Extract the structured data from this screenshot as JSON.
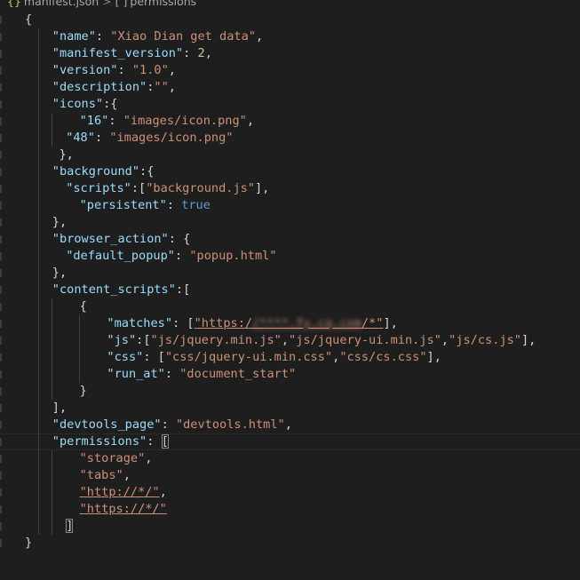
{
  "breadcrumb": {
    "icon": "json-braces-icon",
    "file": "manifest.json",
    "separator": ">",
    "symbol_icon": "[ ]",
    "symbol": "permissions"
  },
  "colors": {
    "background": "#1e1e1e",
    "key": "#9cdcfe",
    "string": "#ce9178",
    "number": "#b5cea8",
    "boolean": "#569cd6",
    "punctuation": "#d4d4d4"
  },
  "lines": [
    {
      "indent": 0,
      "guides": 0,
      "tokens": [
        {
          "t": "p",
          "v": "{"
        }
      ]
    },
    {
      "indent": 2,
      "guides": 1,
      "tokens": [
        {
          "t": "k",
          "v": "\"name\""
        },
        {
          "t": "p",
          "v": ": "
        },
        {
          "t": "s",
          "v": "\"Xiao Dian get data\""
        },
        {
          "t": "p",
          "v": ","
        }
      ]
    },
    {
      "indent": 2,
      "guides": 1,
      "tokens": [
        {
          "t": "k",
          "v": "\"manifest_version\""
        },
        {
          "t": "p",
          "v": ": "
        },
        {
          "t": "n",
          "v": "2"
        },
        {
          "t": "p",
          "v": ","
        }
      ]
    },
    {
      "indent": 2,
      "guides": 1,
      "tokens": [
        {
          "t": "k",
          "v": "\"version\""
        },
        {
          "t": "p",
          "v": ": "
        },
        {
          "t": "s",
          "v": "\"1.0\""
        },
        {
          "t": "p",
          "v": ","
        }
      ]
    },
    {
      "indent": 2,
      "guides": 1,
      "tokens": [
        {
          "t": "k",
          "v": "\"description\""
        },
        {
          "t": "p",
          "v": ":"
        },
        {
          "t": "s",
          "v": "\"\""
        },
        {
          "t": "p",
          "v": ","
        }
      ]
    },
    {
      "indent": 2,
      "guides": 1,
      "tokens": [
        {
          "t": "k",
          "v": "\"icons\""
        },
        {
          "t": "p",
          "v": ":{"
        }
      ]
    },
    {
      "indent": 4,
      "guides": 2,
      "tokens": [
        {
          "t": "k",
          "v": "\"16\""
        },
        {
          "t": "p",
          "v": ": "
        },
        {
          "t": "s",
          "v": "\"images/icon.png\""
        },
        {
          "t": "p",
          "v": ","
        }
      ]
    },
    {
      "indent": 3,
      "guides": 2,
      "tokens": [
        {
          "t": "k",
          "v": "\"48\""
        },
        {
          "t": "p",
          "v": ": "
        },
        {
          "t": "s",
          "v": "\"images/icon.png\""
        }
      ]
    },
    {
      "indent": 2.5,
      "guides": 1,
      "tokens": [
        {
          "t": "p",
          "v": "},"
        }
      ]
    },
    {
      "indent": 2,
      "guides": 1,
      "tokens": [
        {
          "t": "k",
          "v": "\"background\""
        },
        {
          "t": "p",
          "v": ":{"
        }
      ]
    },
    {
      "indent": 3,
      "guides": 1,
      "tokens": [
        {
          "t": "k",
          "v": "\"scripts\""
        },
        {
          "t": "p",
          "v": ":["
        },
        {
          "t": "s",
          "v": "\"background.js\""
        },
        {
          "t": "p",
          "v": "],"
        }
      ]
    },
    {
      "indent": 4,
      "guides": 1,
      "tokens": [
        {
          "t": "k",
          "v": "\"persistent\""
        },
        {
          "t": "p",
          "v": ": "
        },
        {
          "t": "b",
          "v": "true"
        }
      ]
    },
    {
      "indent": 2,
      "guides": 1,
      "tokens": [
        {
          "t": "p",
          "v": "},"
        }
      ]
    },
    {
      "indent": 2,
      "guides": 1,
      "tokens": [
        {
          "t": "k",
          "v": "\"browser_action\""
        },
        {
          "t": "p",
          "v": ": {"
        }
      ]
    },
    {
      "indent": 3,
      "guides": 1,
      "tokens": [
        {
          "t": "k",
          "v": "\"default_popup\""
        },
        {
          "t": "p",
          "v": ": "
        },
        {
          "t": "s",
          "v": "\"popup.html\""
        }
      ]
    },
    {
      "indent": 2,
      "guides": 1,
      "tokens": [
        {
          "t": "p",
          "v": "},"
        }
      ]
    },
    {
      "indent": 2,
      "guides": 1,
      "tokens": [
        {
          "t": "k",
          "v": "\"content_scripts\""
        },
        {
          "t": "p",
          "v": ":["
        }
      ]
    },
    {
      "indent": 4,
      "guides": 2,
      "tokens": [
        {
          "t": "p",
          "v": "{"
        }
      ]
    },
    {
      "indent": 6,
      "guides": 3,
      "tokens": [
        {
          "t": "k",
          "v": "\"matches\""
        },
        {
          "t": "p",
          "v": ": ["
        },
        {
          "t": "su",
          "v": "\"https:/"
        },
        {
          "t": "blur",
          "v": "/****.fy.cq.com"
        },
        {
          "t": "su",
          "v": "/*\""
        },
        {
          "t": "p",
          "v": "],"
        }
      ]
    },
    {
      "indent": 6,
      "guides": 3,
      "tokens": [
        {
          "t": "k",
          "v": "\"js\""
        },
        {
          "t": "p",
          "v": ":["
        },
        {
          "t": "s",
          "v": "\"js/jquery.min.js\""
        },
        {
          "t": "p",
          "v": ","
        },
        {
          "t": "s",
          "v": "\"js/jquery-ui.min.js\""
        },
        {
          "t": "p",
          "v": ","
        },
        {
          "t": "s",
          "v": "\"js/cs.js\""
        },
        {
          "t": "p",
          "v": "],"
        }
      ]
    },
    {
      "indent": 6,
      "guides": 3,
      "tokens": [
        {
          "t": "k",
          "v": "\"css\""
        },
        {
          "t": "p",
          "v": ": ["
        },
        {
          "t": "s",
          "v": "\"css/jquery-ui.min.css\""
        },
        {
          "t": "p",
          "v": ","
        },
        {
          "t": "s",
          "v": "\"css/cs.css\""
        },
        {
          "t": "p",
          "v": "],"
        }
      ]
    },
    {
      "indent": 6,
      "guides": 3,
      "tokens": [
        {
          "t": "k",
          "v": "\"run_at\""
        },
        {
          "t": "p",
          "v": ": "
        },
        {
          "t": "s",
          "v": "\"document_start\""
        }
      ]
    },
    {
      "indent": 4,
      "guides": 2,
      "tokens": [
        {
          "t": "p",
          "v": "}"
        }
      ]
    },
    {
      "indent": 2,
      "guides": 1,
      "tokens": [
        {
          "t": "p",
          "v": "],"
        }
      ]
    },
    {
      "indent": 2,
      "guides": 1,
      "tokens": [
        {
          "t": "k",
          "v": "\"devtools_page\""
        },
        {
          "t": "p",
          "v": ": "
        },
        {
          "t": "s",
          "v": "\"devtools.html\""
        },
        {
          "t": "p",
          "v": ","
        }
      ]
    },
    {
      "indent": 2,
      "guides": 1,
      "active": true,
      "tokens": [
        {
          "t": "k",
          "v": "\"permissions\""
        },
        {
          "t": "p",
          "v": ": "
        },
        {
          "t": "bh",
          "v": "["
        }
      ]
    },
    {
      "indent": 4,
      "guides": 2,
      "tokens": [
        {
          "t": "s",
          "v": "\"storage\""
        },
        {
          "t": "p",
          "v": ","
        }
      ]
    },
    {
      "indent": 4,
      "guides": 2,
      "tokens": [
        {
          "t": "s",
          "v": "\"tabs\""
        },
        {
          "t": "p",
          "v": ","
        }
      ]
    },
    {
      "indent": 4,
      "guides": 2,
      "tokens": [
        {
          "t": "su",
          "v": "\"http://*/\""
        },
        {
          "t": "p",
          "v": ","
        }
      ]
    },
    {
      "indent": 4,
      "guides": 2,
      "tokens": [
        {
          "t": "su",
          "v": "\"https://*/\""
        }
      ]
    },
    {
      "indent": 3,
      "guides": 2,
      "tokens": [
        {
          "t": "bh",
          "v": "]"
        }
      ]
    },
    {
      "indent": 0,
      "guides": 0,
      "tokens": [
        {
          "t": "p",
          "v": "}"
        }
      ]
    }
  ]
}
